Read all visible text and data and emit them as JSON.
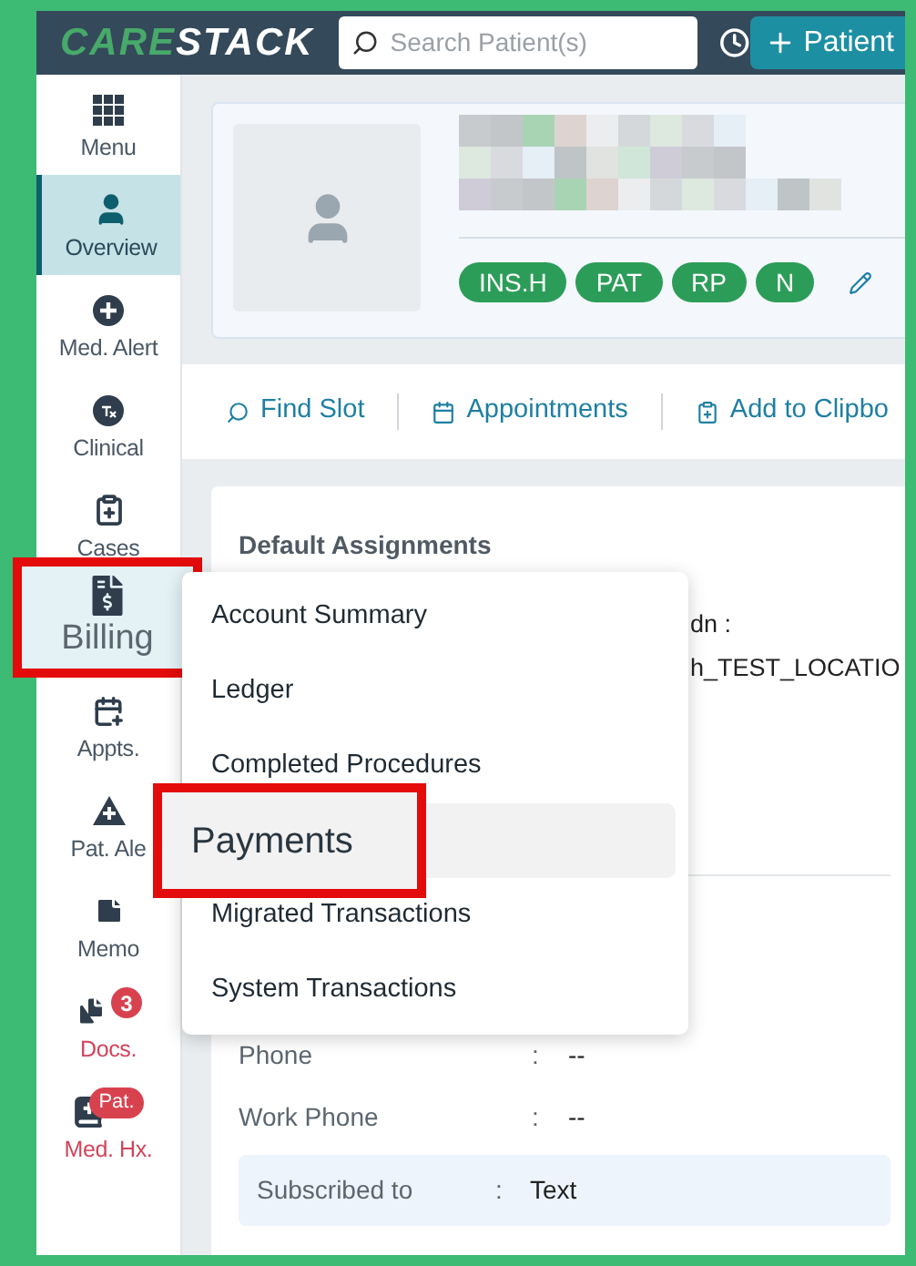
{
  "header": {
    "logo": [
      "CARE",
      "STACK"
    ],
    "search": {
      "placeholder": "Search Patient(s)"
    },
    "add_button": "Patient"
  },
  "sidebar": {
    "items": [
      {
        "label": "Menu",
        "selected": false,
        "highlighted": false,
        "alert": false
      },
      {
        "label": "Overview",
        "selected": true,
        "highlighted": false,
        "alert": false
      },
      {
        "label": "Med. Alert",
        "selected": false,
        "highlighted": false,
        "alert": false
      },
      {
        "label": "Clinical",
        "selected": false,
        "highlighted": false,
        "alert": false
      },
      {
        "label": "Cases",
        "selected": false,
        "highlighted": false,
        "alert": false
      },
      {
        "label": "Billing",
        "selected": false,
        "highlighted": true,
        "alert": false
      },
      {
        "label": "Appts.",
        "selected": false,
        "highlighted": false,
        "alert": false
      },
      {
        "label": "Pat. Ale",
        "selected": false,
        "highlighted": false,
        "alert": false
      },
      {
        "label": "Memo",
        "selected": false,
        "highlighted": false,
        "alert": false
      },
      {
        "label": "Docs.",
        "selected": false,
        "highlighted": false,
        "alert": true,
        "badge": "3"
      },
      {
        "label": "Med. Hx.",
        "selected": false,
        "highlighted": false,
        "alert": true,
        "badge": "Pat."
      }
    ]
  },
  "patient_card": {
    "tags": [
      "INS.H",
      "PAT",
      "RP",
      "N"
    ]
  },
  "toolbar": [
    "Find Slot",
    "Appointments",
    "Add to Clipbo"
  ],
  "details": {
    "title": "Default Assignments",
    "partial_lines": [
      "dn :",
      "h_TEST_LOCATIO"
    ],
    "rows": [
      {
        "label": "Phone",
        "sep": ":",
        "value": "--"
      },
      {
        "label": "Work Phone",
        "sep": ":",
        "value": "--"
      }
    ],
    "subscribed": {
      "label": "Subscribed to",
      "sep": ":",
      "value": "Text"
    }
  },
  "billing_menu": {
    "items": [
      {
        "label": "Account Summary",
        "selected": false
      },
      {
        "label": "Ledger",
        "selected": false
      },
      {
        "label": "Completed Procedures",
        "selected": false
      },
      {
        "label": "Payments",
        "selected": true
      },
      {
        "label": "Migrated Transactions",
        "selected": false
      },
      {
        "label": "System Transactions",
        "selected": false
      }
    ]
  }
}
